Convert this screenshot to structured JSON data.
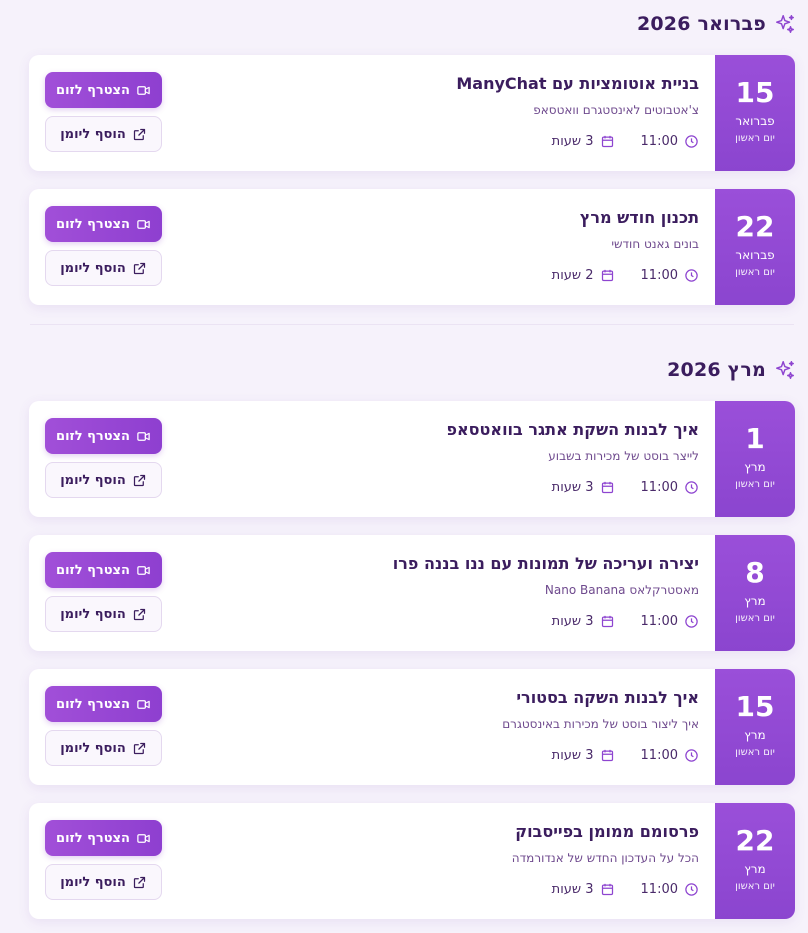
{
  "months": [
    {
      "title": "פברואר 2026",
      "events": [
        {
          "day": "15",
          "month": "פברואר",
          "weekday": "יום ראשון",
          "title": "בניית אוטומציות עם ManyChat",
          "subtitle": "צ'אטבוטים לאינסטגרם וואטסאפ",
          "time": "11:00",
          "duration": "3 שעות"
        },
        {
          "day": "22",
          "month": "פברואר",
          "weekday": "יום ראשון",
          "title": "תכנון חודש מרץ",
          "subtitle": "בונים גאנט חודשי",
          "time": "11:00",
          "duration": "2 שעות"
        }
      ]
    },
    {
      "title": "מרץ 2026",
      "events": [
        {
          "day": "1",
          "month": "מרץ",
          "weekday": "יום ראשון",
          "title": "איך לבנות השקת אתגר בוואטסאפ",
          "subtitle": "לייצר בוסט של מכירות בשבוע",
          "time": "11:00",
          "duration": "3 שעות"
        },
        {
          "day": "8",
          "month": "מרץ",
          "weekday": "יום ראשון",
          "title": "יצירה ועריכה של תמונות עם ננו בננה פרו",
          "subtitle": "מאסטרקלאס Nano Banana",
          "time": "11:00",
          "duration": "3 שעות"
        },
        {
          "day": "15",
          "month": "מרץ",
          "weekday": "יום ראשון",
          "title": "איך לבנות השקה בסטורי",
          "subtitle": "איך ליצור בוסט של מכירות באינסטגרם",
          "time": "11:00",
          "duration": "3 שעות"
        },
        {
          "day": "22",
          "month": "מרץ",
          "weekday": "יום ראשון",
          "title": "פרסומם ממומן בפייסבוק",
          "subtitle": "הכל על העדכון החדש של אנדורמדה",
          "time": "11:00",
          "duration": "3 שעות"
        }
      ]
    }
  ],
  "buttons": {
    "join_zoom": "הצטרף לזום",
    "add_calendar": "הוסף ליומן"
  },
  "icons": {
    "month_header": "sparkle-icon",
    "time": "clock-icon",
    "duration": "calendar-icon",
    "join": "video-camera-icon",
    "add": "external-link-icon"
  },
  "colors": {
    "accent": "#8e45d0",
    "title": "#3b1d5e",
    "background": "#f6f2fb"
  }
}
